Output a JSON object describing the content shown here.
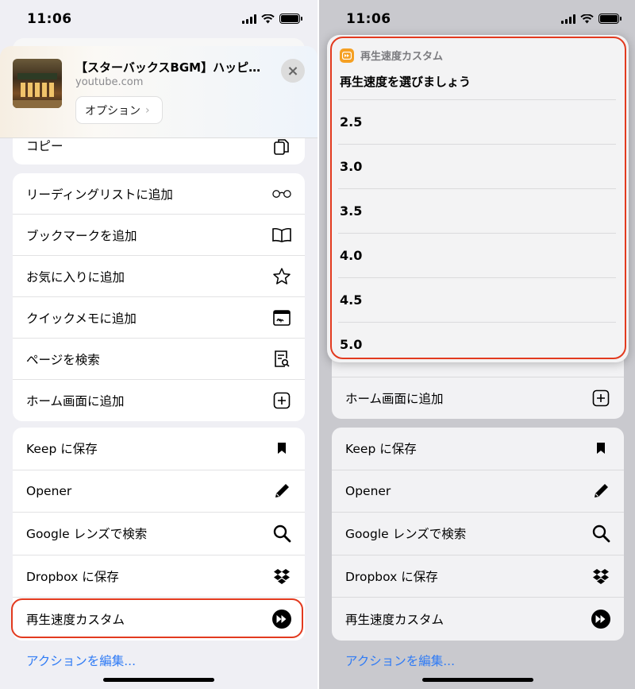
{
  "status": {
    "time": "11:06"
  },
  "share_sheet": {
    "title": "【スターバックスBGM】ハッピ…",
    "domain": "youtube.com",
    "options_label": "オプション",
    "close_label": "×",
    "copy_label": "コピー",
    "group1": [
      {
        "label": "リーディングリストに追加",
        "icon": "glasses-icon"
      },
      {
        "label": "ブックマークを追加",
        "icon": "book-icon"
      },
      {
        "label": "お気に入りに追加",
        "icon": "star-icon"
      },
      {
        "label": "クイックメモに追加",
        "icon": "quick-note-icon"
      },
      {
        "label": "ページを検索",
        "icon": "find-in-page-icon"
      },
      {
        "label": "ホーム画面に追加",
        "icon": "add-square-icon"
      }
    ],
    "group2": [
      {
        "label": "Keep に保存",
        "icon": "bookmark-icon"
      },
      {
        "label": "Opener",
        "icon": "pencil-icon"
      },
      {
        "label": "Google レンズで検索",
        "icon": "magnifier-icon"
      },
      {
        "label": "Dropbox に保存",
        "icon": "dropbox-icon"
      },
      {
        "label": "再生速度カスタム",
        "icon": "fast-forward-icon"
      }
    ],
    "edit_actions": "アクションを編集..."
  },
  "shortcut_popup": {
    "app_name": "再生速度カスタム",
    "prompt": "再生速度を選びましょう",
    "choices": [
      "2.5",
      "3.0",
      "3.5",
      "4.0",
      "4.5",
      "5.0"
    ]
  },
  "colors": {
    "highlight": "#e23a1f",
    "link": "#2f7bf5",
    "shortcut_icon": "#f5a023"
  }
}
